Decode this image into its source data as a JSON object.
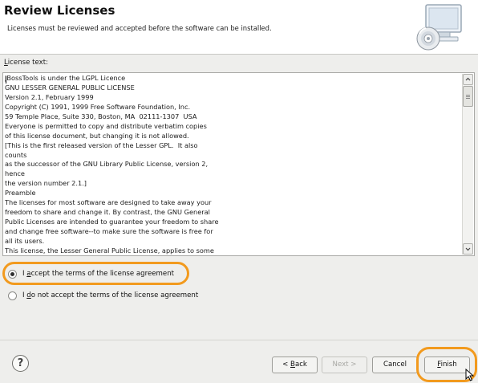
{
  "header": {
    "title": "Review Licenses",
    "subtitle": "Licenses must be reviewed and accepted before the software can be installed.",
    "icon": "cd-install-icon"
  },
  "license": {
    "label_mnemonic": "L",
    "label_rest": "icense text:",
    "lines": [
      "JBossTools is under the LGPL Licence",
      "GNU LESSER GENERAL PUBLIC LICENSE",
      "Version 2.1, February 1999",
      "Copyright (C) 1991, 1999 Free Software Foundation, Inc.",
      "59 Temple Place, Suite 330, Boston, MA  02111-1307  USA",
      "Everyone is permitted to copy and distribute verbatim copies",
      "of this license document, but changing it is not allowed.",
      "[This is the first released version of the Lesser GPL.  It also",
      "counts",
      "as the successor of the GNU Library Public License, version 2,",
      "hence",
      "the version number 2.1.]",
      "Preamble",
      "The licenses for most software are designed to take away your",
      "freedom to share and change it. By contrast, the GNU General",
      "Public Licenses are intended to guarantee your freedom to share",
      "and change free software--to make sure the software is free for",
      "all its users.",
      "This license, the Lesser General Public License, applies to some"
    ]
  },
  "options": {
    "accept": {
      "m1": "I ",
      "mnemonic": "a",
      "m2": "ccept the terms of the license agreement",
      "selected": true
    },
    "decline": {
      "m1": "I ",
      "mnemonic": "d",
      "m2": "o not accept the terms of the license agreement",
      "selected": false
    }
  },
  "buttons": {
    "help": "?",
    "back": {
      "prefix": "< ",
      "mnemonic": "B",
      "rest": "ack"
    },
    "next": {
      "text": "Next >",
      "enabled": false
    },
    "cancel": "Cancel",
    "finish": {
      "mnemonic": "F",
      "rest": "inish"
    }
  },
  "colors": {
    "highlight_ring": "#f29a1e",
    "background": "#eeeeec"
  }
}
